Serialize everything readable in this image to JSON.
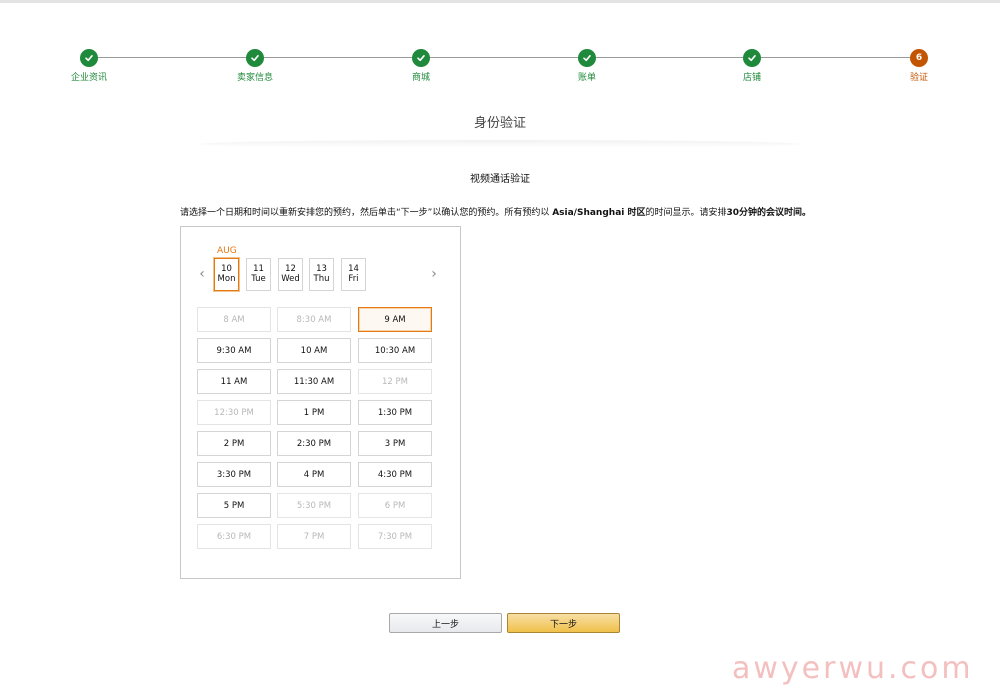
{
  "stepper": {
    "steps": [
      {
        "label": "企业资讯",
        "state": "done"
      },
      {
        "label": "卖家信息",
        "state": "done"
      },
      {
        "label": "商城",
        "state": "done"
      },
      {
        "label": "账单",
        "state": "done"
      },
      {
        "label": "店铺",
        "state": "done"
      },
      {
        "label": "验证",
        "state": "current",
        "number": "6"
      }
    ]
  },
  "page_title": "身份验证",
  "section_title": "视频通话验证",
  "instruction": {
    "part1": "请选择一个日期和时间以重新安排您的预约，然后单击“下一步”以确认您的预约。所有预约以 ",
    "timezone": "Asia/Shanghai 时区",
    "part2": "的时间显示。请安排",
    "duration": "30分钟的会议时间。"
  },
  "calendar": {
    "month": "AUG",
    "prev_arrow": "‹",
    "next_arrow": "›",
    "days": [
      {
        "num": "10",
        "dow": "Mon",
        "selected": true
      },
      {
        "num": "11",
        "dow": "Tue",
        "selected": false
      },
      {
        "num": "12",
        "dow": "Wed",
        "selected": false
      },
      {
        "num": "13",
        "dow": "Thu",
        "selected": false
      },
      {
        "num": "14",
        "dow": "Fri",
        "selected": false
      }
    ]
  },
  "slots": [
    {
      "label": "8 AM",
      "state": "disabled"
    },
    {
      "label": "8:30 AM",
      "state": "disabled"
    },
    {
      "label": "9 AM",
      "state": "selected"
    },
    {
      "label": "9:30 AM",
      "state": "available"
    },
    {
      "label": "10 AM",
      "state": "available"
    },
    {
      "label": "10:30 AM",
      "state": "available"
    },
    {
      "label": "11 AM",
      "state": "available"
    },
    {
      "label": "11:30 AM",
      "state": "available"
    },
    {
      "label": "12 PM",
      "state": "disabled"
    },
    {
      "label": "12:30 PM",
      "state": "disabled"
    },
    {
      "label": "1 PM",
      "state": "available"
    },
    {
      "label": "1:30 PM",
      "state": "available"
    },
    {
      "label": "2 PM",
      "state": "available"
    },
    {
      "label": "2:30 PM",
      "state": "available"
    },
    {
      "label": "3 PM",
      "state": "available"
    },
    {
      "label": "3:30 PM",
      "state": "available"
    },
    {
      "label": "4 PM",
      "state": "available"
    },
    {
      "label": "4:30 PM",
      "state": "available"
    },
    {
      "label": "5 PM",
      "state": "available"
    },
    {
      "label": "5:30 PM",
      "state": "disabled"
    },
    {
      "label": "6 PM",
      "state": "disabled"
    },
    {
      "label": "6:30 PM",
      "state": "disabled"
    },
    {
      "label": "7 PM",
      "state": "disabled"
    },
    {
      "label": "7:30 PM",
      "state": "disabled"
    }
  ],
  "buttons": {
    "prev": "上一步",
    "next": "下一步"
  },
  "watermark": "awyerwu.com",
  "colors": {
    "done": "#1f8a3b",
    "current": "#c45500",
    "accent": "#e47911",
    "primary_button": "#f0c14b"
  }
}
